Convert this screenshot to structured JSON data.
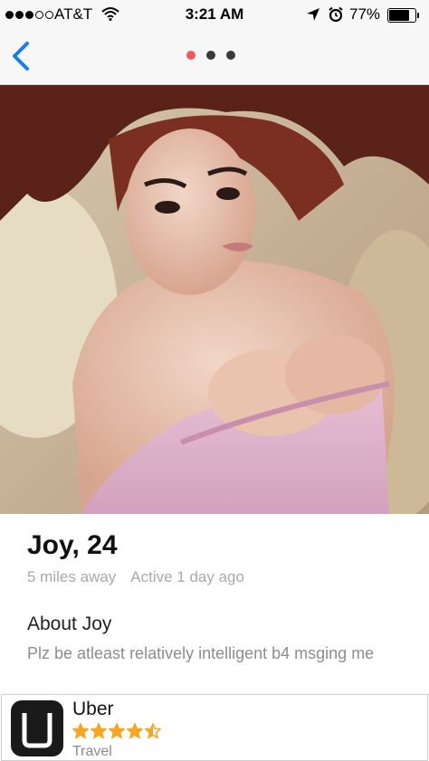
{
  "status_bar": {
    "carrier": "AT&T",
    "time": "3:21 AM",
    "battery_percent": "77%",
    "battery_level": 0.77,
    "signal_bars_filled": 3,
    "signal_bars_total": 5
  },
  "nav": {
    "back_icon": "chevron-left-icon",
    "page_count": 3,
    "active_page": 1,
    "active_color": "#f25a5a",
    "inactive_color": "#3a3a3a",
    "accent_color": "#1a7cf0"
  },
  "profile": {
    "name_age": "Joy, 24",
    "distance": "5 miles away",
    "active": "Active 1 day ago",
    "about_title": "About Joy",
    "bio": "Plz be atleast relatively intelligent b4 msging me"
  },
  "app_card": {
    "name": "Uber",
    "rating": 4.5,
    "rating_max": 5,
    "category": "Travel",
    "star_color": "#f5a623"
  }
}
